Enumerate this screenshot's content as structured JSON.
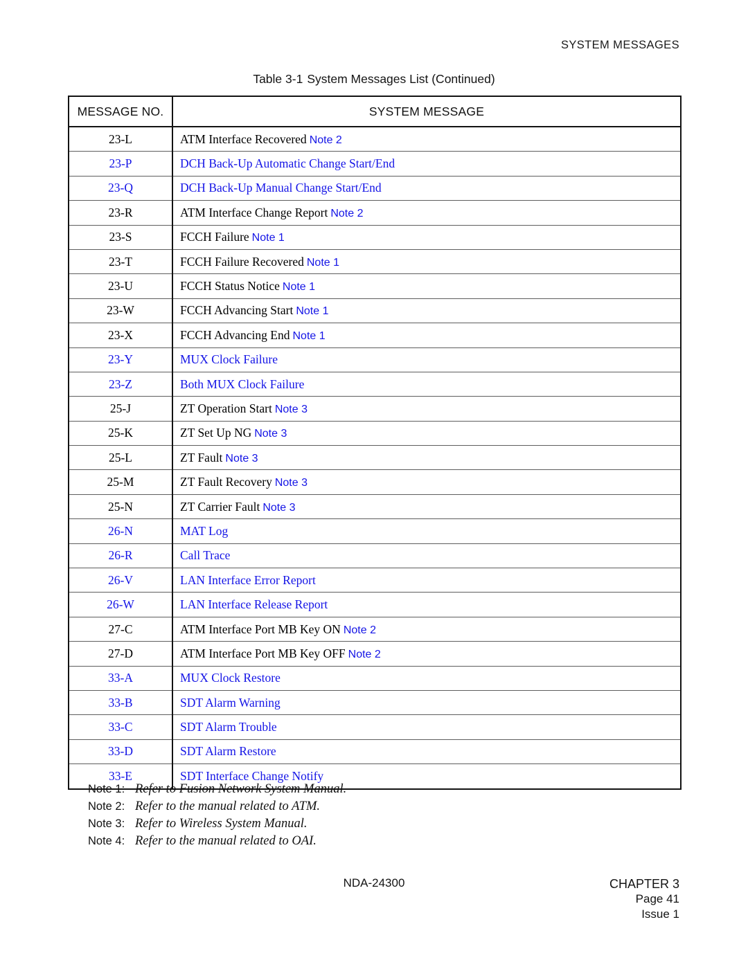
{
  "page_header": "SYSTEM MESSAGES",
  "table_caption": {
    "label": "Table 3-1",
    "title": "System Messages List (Continued)"
  },
  "table": {
    "columns": [
      "MESSAGE NO.",
      "SYSTEM MESSAGE"
    ],
    "highlight_color": "#1414e6",
    "rows": [
      {
        "no": "23-L",
        "msg": "ATM Interface Recovered",
        "note": "Note 2",
        "blue": false
      },
      {
        "no": "23-P",
        "msg": "DCH Back-Up Automatic Change Start/End",
        "note": "",
        "blue": true
      },
      {
        "no": "23-Q",
        "msg": "DCH Back-Up Manual Change Start/End",
        "note": "",
        "blue": true
      },
      {
        "no": "23-R",
        "msg": "ATM Interface Change Report",
        "note": "Note 2",
        "blue": false
      },
      {
        "no": "23-S",
        "msg": "FCCH Failure",
        "note": "Note 1",
        "blue": false
      },
      {
        "no": "23-T",
        "msg": "FCCH Failure Recovered",
        "note": "Note 1",
        "blue": false
      },
      {
        "no": "23-U",
        "msg": "FCCH Status Notice",
        "note": "Note 1",
        "blue": false
      },
      {
        "no": "23-W",
        "msg": "FCCH Advancing Start",
        "note": "Note 1",
        "blue": false
      },
      {
        "no": "23-X",
        "msg": "FCCH Advancing End",
        "note": "Note 1",
        "blue": false
      },
      {
        "no": "23-Y",
        "msg": "MUX Clock Failure",
        "note": "",
        "blue": true
      },
      {
        "no": "23-Z",
        "msg": "Both MUX Clock Failure",
        "note": "",
        "blue": true
      },
      {
        "no": "25-J",
        "msg": "ZT Operation Start",
        "note": "Note 3",
        "blue": false
      },
      {
        "no": "25-K",
        "msg": "ZT Set Up NG",
        "note": "Note 3",
        "blue": false
      },
      {
        "no": "25-L",
        "msg": "ZT Fault",
        "note": "Note 3",
        "blue": false
      },
      {
        "no": "25-M",
        "msg": "ZT Fault Recovery",
        "note": "Note 3",
        "blue": false
      },
      {
        "no": "25-N",
        "msg": "ZT Carrier Fault",
        "note": "Note 3",
        "blue": false
      },
      {
        "no": "26-N",
        "msg": "MAT Log",
        "note": "",
        "blue": true
      },
      {
        "no": "26-R",
        "msg": "Call Trace",
        "note": "",
        "blue": true
      },
      {
        "no": "26-V",
        "msg": "LAN Interface Error Report",
        "note": "",
        "blue": true
      },
      {
        "no": "26-W",
        "msg": "LAN Interface Release Report",
        "note": "",
        "blue": true
      },
      {
        "no": "27-C",
        "msg": "ATM Interface Port MB Key ON",
        "note": "Note 2",
        "blue": false
      },
      {
        "no": "27-D",
        "msg": "ATM Interface Port MB Key OFF",
        "note": "Note 2",
        "blue": false
      },
      {
        "no": "33-A",
        "msg": "MUX Clock Restore",
        "note": "",
        "blue": true
      },
      {
        "no": "33-B",
        "msg": "SDT Alarm Warning",
        "note": "",
        "blue": true
      },
      {
        "no": "33-C",
        "msg": "SDT Alarm Trouble",
        "note": "",
        "blue": true
      },
      {
        "no": "33-D",
        "msg": "SDT Alarm Restore",
        "note": "",
        "blue": true
      },
      {
        "no": "33-E",
        "msg": "SDT Interface Change Notify",
        "note": "",
        "blue": true
      }
    ]
  },
  "footnotes": [
    {
      "label": "Note 1:",
      "text": "Refer to Fusion Network System Manual."
    },
    {
      "label": "Note 2:",
      "text": "Refer to the manual related to ATM."
    },
    {
      "label": "Note 3:",
      "text": "Refer to Wireless System Manual."
    },
    {
      "label": "Note 4:",
      "text": "Refer to the manual related to OAI."
    }
  ],
  "footer": {
    "document_number": "NDA-24300",
    "chapter": "CHAPTER 3",
    "page": "Page 41",
    "issue": "Issue 1"
  }
}
